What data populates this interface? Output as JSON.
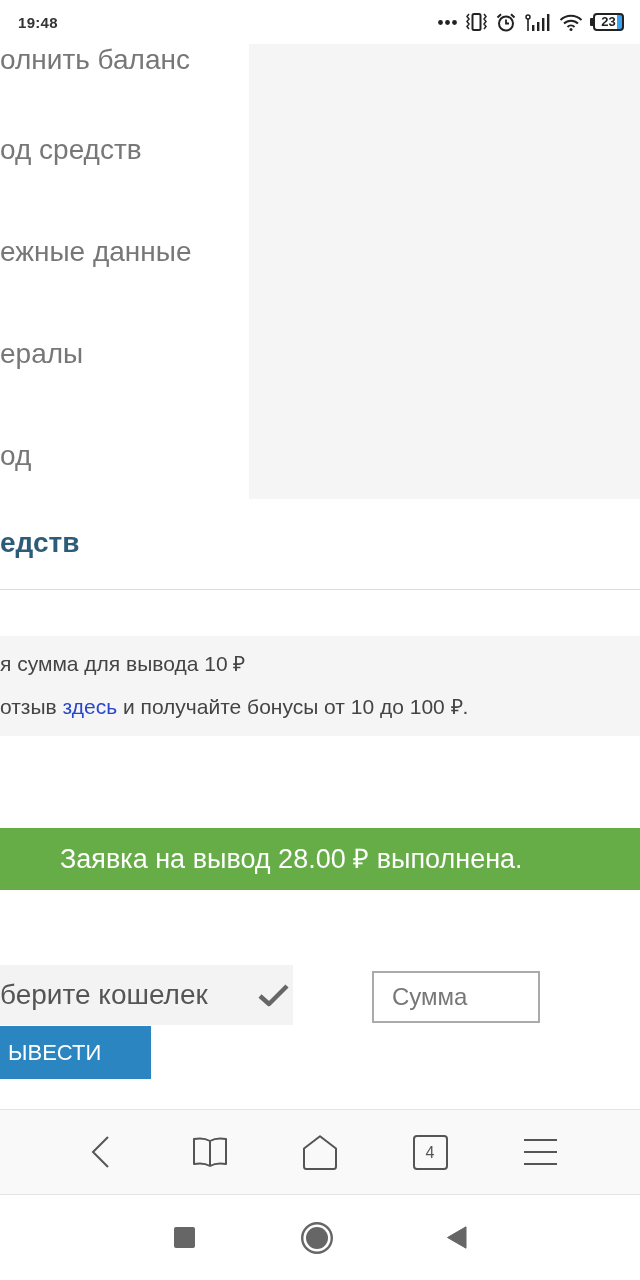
{
  "status_bar": {
    "time": "19:48",
    "battery": "23"
  },
  "sidebar": {
    "items": [
      {
        "label": "олнить баланс"
      },
      {
        "label": "од средств"
      },
      {
        "label": "ежные данные"
      },
      {
        "label": "ералы"
      },
      {
        "label": "од"
      }
    ]
  },
  "content": {
    "heading": "едств",
    "info": {
      "lines": [
        {
          "parts": [
            {
              "kind": "text",
              "text": "я сумма для вывода 10 ₽"
            }
          ]
        },
        {
          "parts": [
            {
              "kind": "text",
              "text": "отзыв "
            },
            {
              "kind": "link",
              "text": "здесь"
            },
            {
              "kind": "text",
              "text": " и получайте бонусы от 10 до 100 ₽."
            }
          ]
        }
      ]
    },
    "alert": {
      "kind": "success",
      "text": "Заявка на вывод 28.00 ₽ выполнена."
    },
    "form": {
      "wallet": {
        "value": "берите кошелек"
      },
      "amount": {
        "placeholder": "Сумма"
      },
      "submit": "ЫВЕСТИ"
    }
  },
  "browser_toolbar": {
    "tab_count": "4"
  }
}
